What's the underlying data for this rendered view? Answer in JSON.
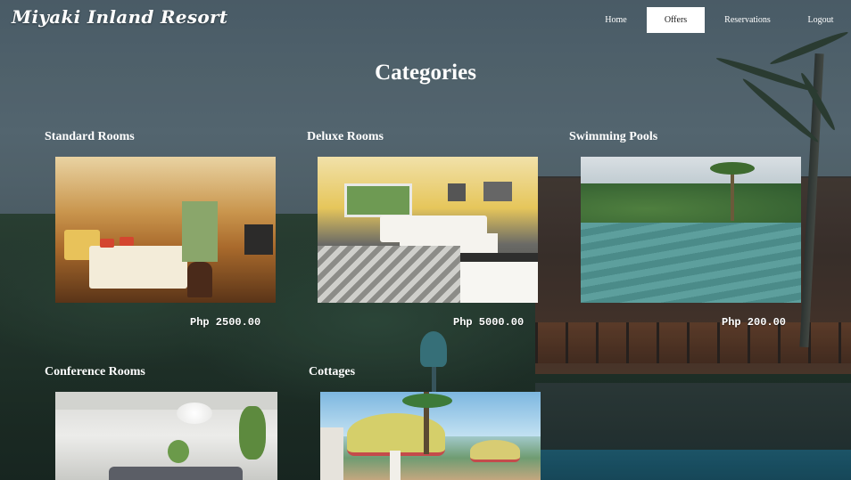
{
  "header": {
    "brand": "Miyaki Inland Resort",
    "nav": [
      {
        "label": "Home",
        "active": false
      },
      {
        "label": "Offers",
        "active": true
      },
      {
        "label": "Reservations",
        "active": false
      },
      {
        "label": "Logout",
        "active": false
      }
    ]
  },
  "page": {
    "title": "Categories"
  },
  "categories": [
    {
      "name": "Standard Rooms",
      "price": "Php 2500.00"
    },
    {
      "name": "Deluxe Rooms",
      "price": "Php 5000.00"
    },
    {
      "name": "Swimming Pools",
      "price": "Php 200.00"
    },
    {
      "name": "Conference Rooms",
      "price": ""
    },
    {
      "name": "Cottages",
      "price": ""
    }
  ],
  "colors": {
    "nav_active_bg": "#ffffff",
    "text": "#ffffff"
  }
}
